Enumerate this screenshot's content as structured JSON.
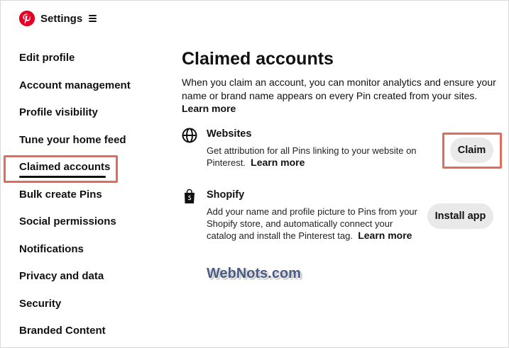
{
  "header": {
    "title": "Settings",
    "logo_icon": "pinterest-logo",
    "menu_icon": "hamburger-icon",
    "brand_color": "#e60023"
  },
  "sidebar": {
    "items": [
      {
        "label": "Edit profile"
      },
      {
        "label": "Account management"
      },
      {
        "label": "Profile visibility"
      },
      {
        "label": "Tune your home feed"
      },
      {
        "label": "Claimed accounts",
        "active": true
      },
      {
        "label": "Bulk create Pins"
      },
      {
        "label": "Social permissions"
      },
      {
        "label": "Notifications"
      },
      {
        "label": "Privacy and data"
      },
      {
        "label": "Security"
      },
      {
        "label": "Branded Content"
      }
    ]
  },
  "main": {
    "title": "Claimed accounts",
    "intro": "When you claim an account, you can monitor analytics and ensure your name or brand name appears on every Pin created from your sites.",
    "learn_more": "Learn more",
    "websites": {
      "icon": "globe-icon",
      "title": "Websites",
      "desc": "Get attribution for all Pins linking to your website on Pinterest.",
      "learn_more": "Learn more",
      "button": "Claim"
    },
    "shopify": {
      "icon": "shopify-bag-icon",
      "title": "Shopify",
      "desc": "Add your name and profile picture to Pins from your Shopify store, and automatically connect your catalog and install the Pinterest tag.",
      "learn_more": "Learn more",
      "button": "Install app"
    }
  },
  "watermark": "WebNots.com",
  "highlight_color": "#e06c5c"
}
